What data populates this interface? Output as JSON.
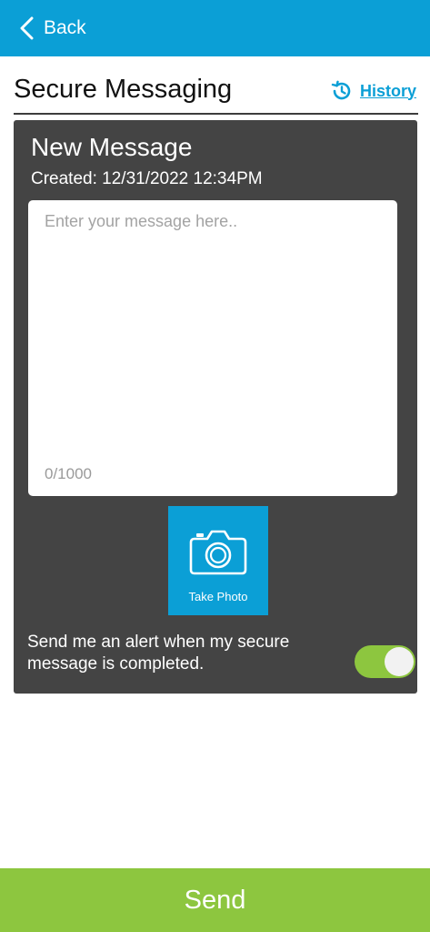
{
  "topbar": {
    "back_label": "Back"
  },
  "header": {
    "title": "Secure Messaging",
    "history_label": "History"
  },
  "card": {
    "title": "New Message",
    "created": "Created: 12/31/2022 12:34PM",
    "message_placeholder": "Enter your message here..",
    "message_value": "",
    "counter": "0/1000",
    "photo_label": "Take Photo",
    "alert_text": "Send me an alert when my secure message is completed.",
    "alert_toggle_on": true
  },
  "footer": {
    "send_label": "Send"
  },
  "colors": {
    "brand_blue": "#0b9fd6",
    "accent_green": "#8dc63f",
    "card_gray": "#444444"
  }
}
